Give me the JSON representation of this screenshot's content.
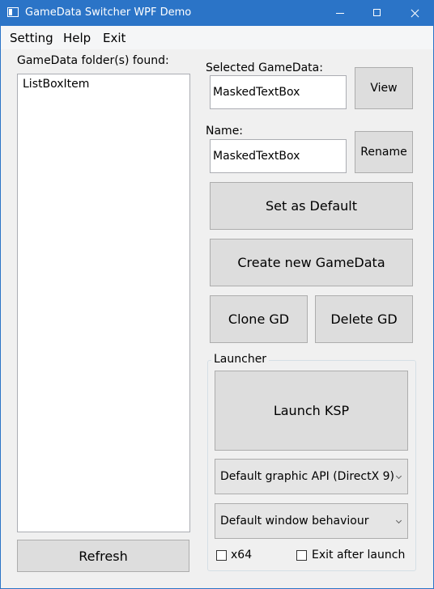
{
  "window": {
    "title": "GameData Switcher WPF Demo"
  },
  "menu": [
    "Setting",
    "Help",
    "Exit"
  ],
  "left": {
    "label": "GameData folder(s) found:",
    "items": [
      "ListBoxItem"
    ],
    "refresh": "Refresh"
  },
  "selected": {
    "label": "Selected GameData:",
    "value": "MaskedTextBox",
    "view": "View"
  },
  "name": {
    "label": "Name:",
    "value": "MaskedTextBox",
    "rename": "Rename"
  },
  "actions": {
    "set_default": "Set as Default",
    "create_new": "Create new GameData",
    "clone": "Clone GD",
    "delete": "Delete GD"
  },
  "launcher": {
    "title": "Launcher",
    "launch": "Launch KSP",
    "graphics_api": "Default graphic API (DirectX 9)",
    "window_behaviour": "Default window behaviour",
    "x64_label": "x64",
    "exit_after_label": "Exit after launch",
    "x64_checked": false,
    "exit_after_checked": false
  },
  "colors": {
    "titlebar": "#2b74c7",
    "window_bg": "#f0f0f0",
    "button": "#dddddd"
  }
}
